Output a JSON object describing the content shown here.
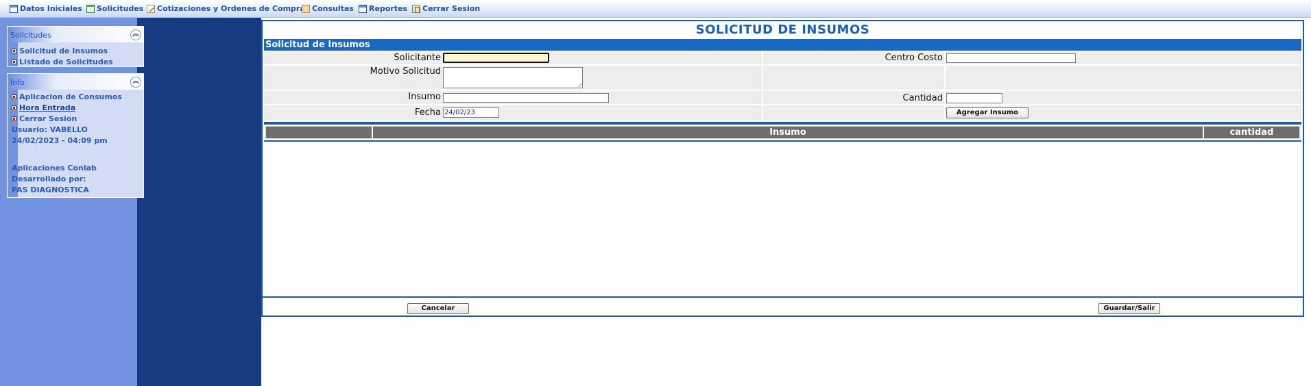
{
  "menu": {
    "items": [
      {
        "label": "Datos Iniciales",
        "icon": "document-icon"
      },
      {
        "label": "Solicitudes",
        "icon": "spreadsheet-icon"
      },
      {
        "label": "Cotizaciones y Ordenes de Compra",
        "icon": "pencil-icon"
      },
      {
        "label": "Consultas",
        "icon": "calculator-icon"
      },
      {
        "label": "Reportes",
        "icon": "report-icon"
      },
      {
        "label": "Cerrar Sesion",
        "icon": "exit-icon"
      }
    ]
  },
  "sidebar": {
    "solicitudes_panel": {
      "title": "Solicitudes",
      "items": [
        "Solicitud de Insumos",
        "Listado de Solicitudes"
      ]
    },
    "info_panel": {
      "title": "Info",
      "items": [
        "Aplicacion de Consumos",
        "Hora Entrada",
        "Cerrar Sesion"
      ],
      "user_line": "Usuario: VABELLO",
      "datetime_line": "24/02/2023 - 04:09 pm",
      "app_line": "Aplicaciones Conlab",
      "dev_line": "Desarrollado por:",
      "company_line": "PAS DIAGNOSTICA"
    }
  },
  "form": {
    "page_title": "SOLICITUD DE INSUMOS",
    "section_title": "Solicitud de Insumos",
    "labels": {
      "solicitante": "Solicitante",
      "centro_costo": "Centro Costo",
      "motivo": "Motivo Solicitud",
      "insumo": "Insumo",
      "cantidad": "Cantidad",
      "fecha": "Fecha"
    },
    "values": {
      "solicitante": "",
      "centro_costo": "",
      "motivo": "",
      "insumo": "",
      "cantidad": "",
      "fecha": "24/02/23"
    },
    "add_button": "Agregar Insumo",
    "table_headers": [
      "",
      "Insumo",
      "cantidad"
    ],
    "cancel_button": "Cancelar",
    "save_button": "Guardar/Salir"
  },
  "colors": {
    "accent_blue": "#1869c5",
    "sidebar_blue": "#7293df",
    "dark_blue": "#173b80",
    "link_blue": "#2a5bb8"
  }
}
